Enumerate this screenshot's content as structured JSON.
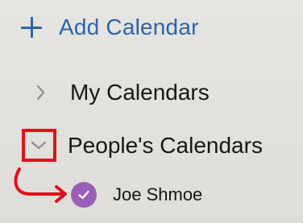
{
  "sidebar": {
    "add_calendar": {
      "label": "Add Calendar",
      "icon": "plus-icon"
    },
    "groups": [
      {
        "label": "My Calendars",
        "expanded": false,
        "icon": "chevron-right-icon"
      },
      {
        "label": "People's Calendars",
        "expanded": true,
        "icon": "chevron-down-icon",
        "items": [
          {
            "label": "Joe Shmoe",
            "checked": true,
            "color": "#9a5fb6"
          }
        ]
      }
    ]
  },
  "colors": {
    "accent": "#2f63a8",
    "annotation": "#e0111b",
    "background": "#e3e1dd"
  }
}
